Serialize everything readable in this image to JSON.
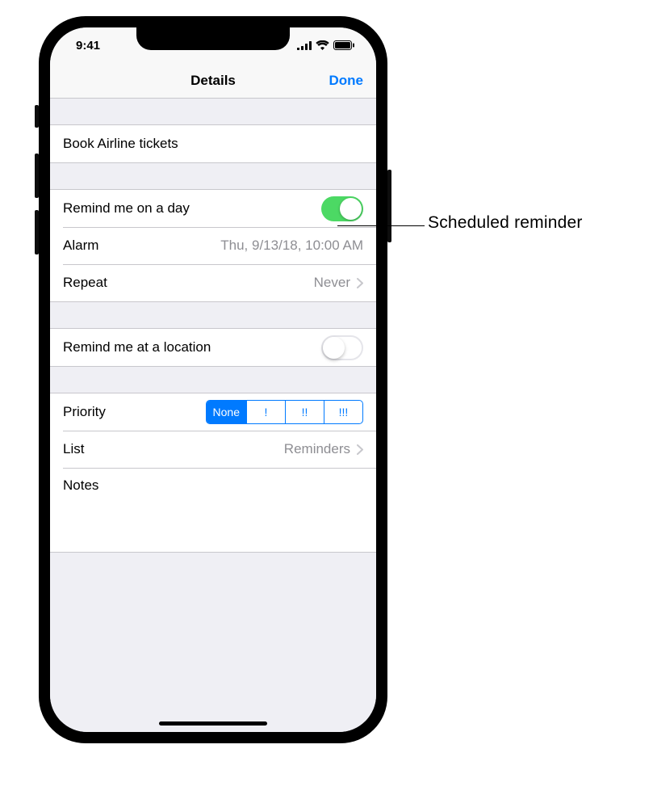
{
  "status": {
    "time": "9:41"
  },
  "nav": {
    "title": "Details",
    "done": "Done"
  },
  "reminder": {
    "title": "Book Airline tickets"
  },
  "day": {
    "label": "Remind me on a day",
    "on": true,
    "alarm_label": "Alarm",
    "alarm_value": "Thu, 9/13/18, 10:00 AM",
    "repeat_label": "Repeat",
    "repeat_value": "Never"
  },
  "location": {
    "label": "Remind me at a location",
    "on": false
  },
  "priority": {
    "label": "Priority",
    "options": [
      "None",
      "!",
      "!!",
      "!!!"
    ],
    "selected": "None"
  },
  "list": {
    "label": "List",
    "value": "Reminders"
  },
  "notes": {
    "label": "Notes"
  },
  "callout": {
    "text": "Scheduled reminder"
  }
}
